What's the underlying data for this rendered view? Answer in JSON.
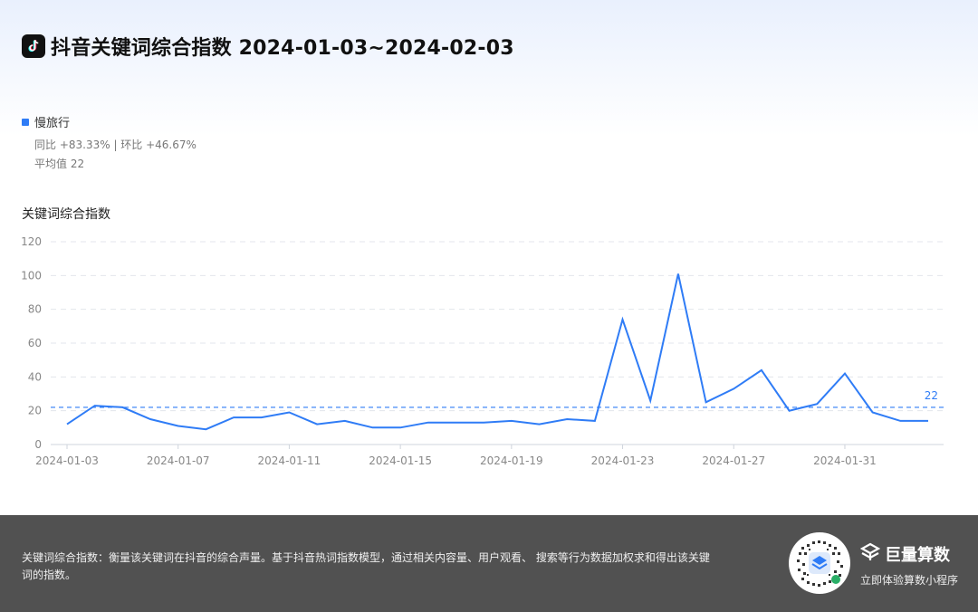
{
  "header": {
    "title": "抖音关键词综合指数 2024-01-03~2024-02-03",
    "logo_icon": "douyin-logo-icon"
  },
  "legend": {
    "series_name": "慢旅行",
    "change": "同比 +83.33% | 环比 +46.67%",
    "average": "平均值 22",
    "color": "#2f7cf6"
  },
  "chart_data": {
    "type": "line",
    "title": "关键词综合指数",
    "x": [
      "2024-01-03",
      "2024-01-04",
      "2024-01-05",
      "2024-01-06",
      "2024-01-07",
      "2024-01-08",
      "2024-01-09",
      "2024-01-10",
      "2024-01-11",
      "2024-01-12",
      "2024-01-13",
      "2024-01-14",
      "2024-01-15",
      "2024-01-16",
      "2024-01-17",
      "2024-01-18",
      "2024-01-19",
      "2024-01-20",
      "2024-01-21",
      "2024-01-22",
      "2024-01-23",
      "2024-01-24",
      "2024-01-25",
      "2024-01-26",
      "2024-01-27",
      "2024-01-28",
      "2024-01-29",
      "2024-01-30",
      "2024-01-31",
      "2024-02-01",
      "2024-02-02",
      "2024-02-03"
    ],
    "series": [
      {
        "name": "慢旅行",
        "values": [
          12,
          23,
          22,
          15,
          11,
          9,
          16,
          16,
          19,
          12,
          14,
          10,
          10,
          13,
          13,
          13,
          14,
          12,
          15,
          14,
          74,
          26,
          101,
          25,
          33,
          44,
          20,
          24,
          42,
          19,
          14,
          14
        ]
      }
    ],
    "x_tick_labels": [
      "2024-01-03",
      "2024-01-07",
      "2024-01-11",
      "2024-01-15",
      "2024-01-19",
      "2024-01-23",
      "2024-01-27",
      "2024-01-31"
    ],
    "y_ticks": [
      0,
      20,
      40,
      60,
      80,
      100,
      120
    ],
    "ylim": [
      0,
      120
    ],
    "average_line": 22,
    "average_label": "22",
    "grid": true,
    "line_color": "#2f7cf6"
  },
  "footer": {
    "description": "关键词综合指数：衡量该关键词在抖音的综合声量。基于抖音热词指数模型，通过相关内容量、用户观看、 搜索等行为数据加权求和得出该关键词的指数。",
    "brand_name": "巨量算数",
    "brand_subtitle": "立即体验算数小程序",
    "brand_icon": "juliang-logo-icon",
    "qr_icon": "mini-program-qr-code-icon",
    "background": "#515151"
  }
}
